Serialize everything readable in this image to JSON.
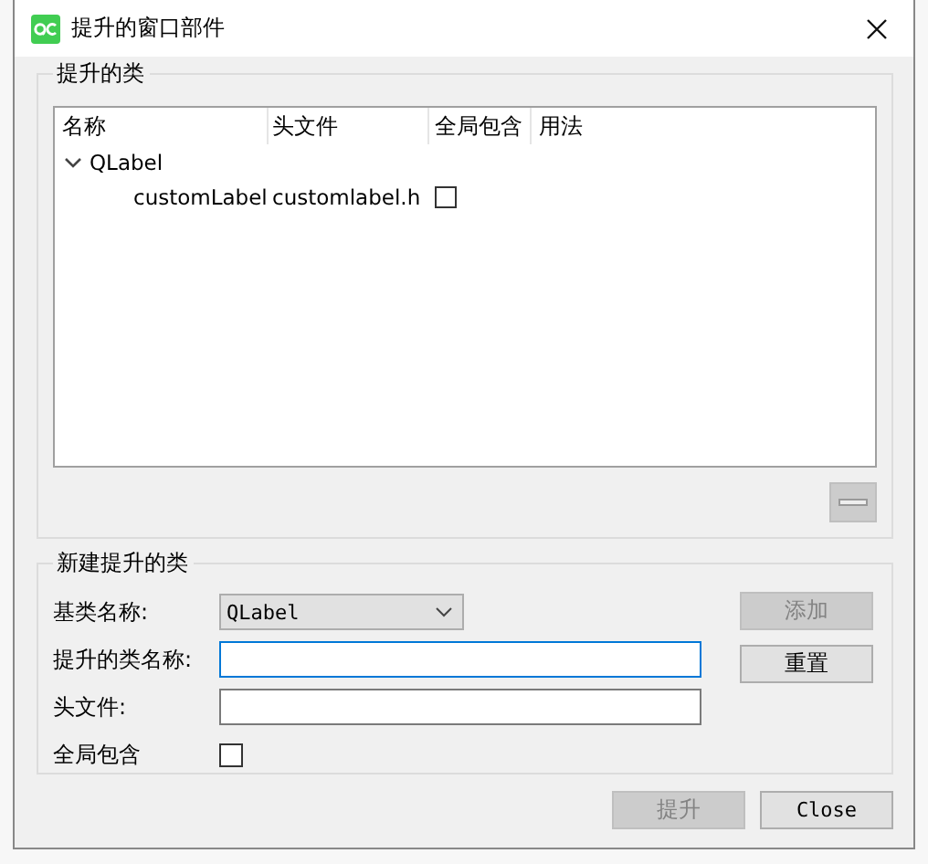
{
  "window": {
    "title": "提升的窗口部件"
  },
  "promoted_classes": {
    "title": "提升的类",
    "columns": [
      "名称",
      "头文件",
      "全局包含",
      "用法"
    ],
    "rows": [
      {
        "name": "QLabel",
        "expanded": true,
        "children": [
          {
            "name": "customLabel",
            "header": "customlabel.h",
            "global_include": false
          }
        ]
      }
    ],
    "remove_button": {
      "disabled": true
    }
  },
  "new_class": {
    "title": "新建提升的类",
    "base_class": {
      "label": "基类名称:",
      "value": "QLabel"
    },
    "class_name": {
      "label": "提升的类名称:",
      "focused": true
    },
    "header_file": {
      "label": "头文件:",
      "focused": false
    },
    "global_include": {
      "label": "全局包含",
      "checked": false
    },
    "buttons": [
      {
        "label": "添加",
        "disabled": true
      },
      {
        "label": "重置",
        "disabled": false
      }
    ]
  },
  "footer_buttons": [
    {
      "label": "提升",
      "disabled": true,
      "kind": "cjk"
    },
    {
      "label": "Close",
      "disabled": false,
      "kind": "mono"
    }
  ]
}
